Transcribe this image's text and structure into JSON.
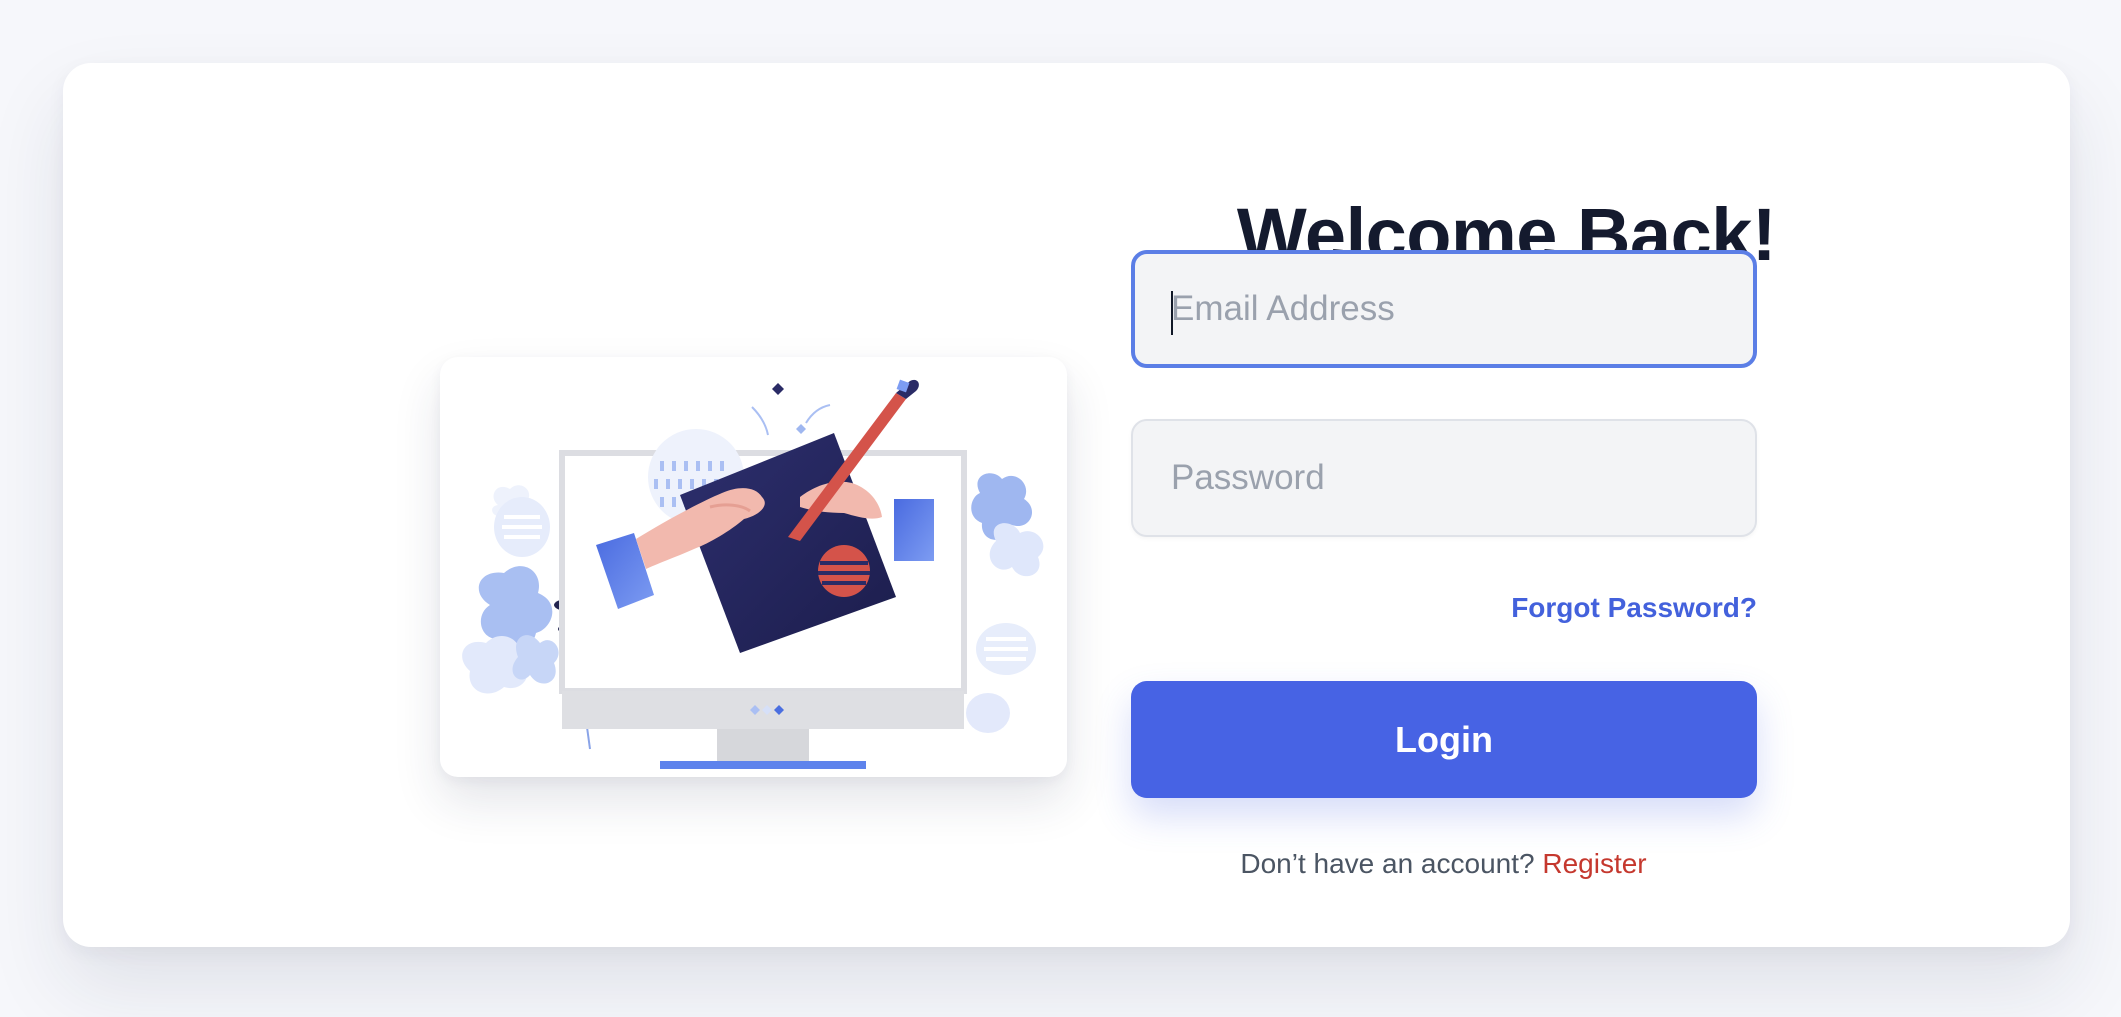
{
  "login": {
    "title": "Welcome Back!",
    "email_placeholder": "Email Address",
    "email_value": "",
    "password_placeholder": "Password",
    "password_value": "",
    "forgot_password": "Forgot Password?",
    "login_button": "Login",
    "no_account_text": "Don’t have an account?",
    "register_link": "Register"
  },
  "colors": {
    "primary": "#4763e4",
    "focus_border": "#5b7ee6",
    "register": "#c5382e",
    "title": "#141a2e"
  },
  "illustration": {
    "icon": "computer-drawing-illustration"
  }
}
